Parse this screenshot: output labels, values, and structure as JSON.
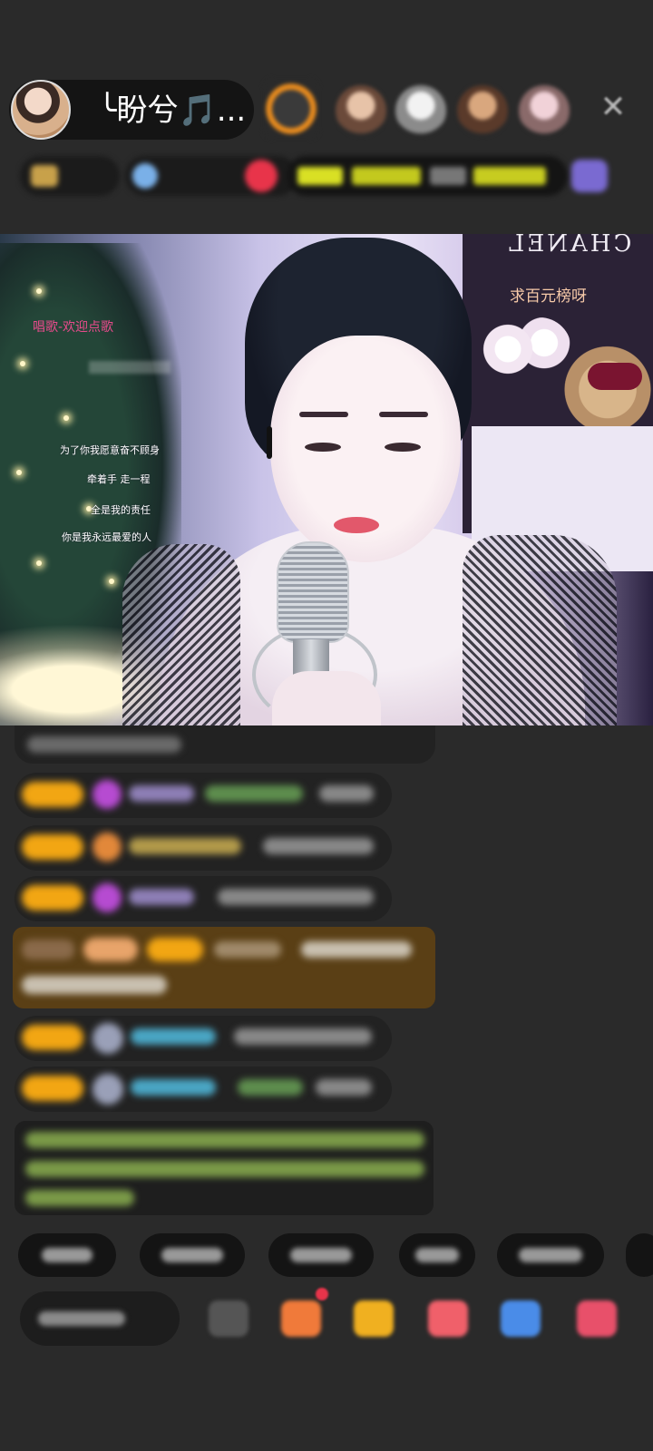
{
  "host": {
    "name": "╰盼兮🎵..."
  },
  "top_icons": {
    "close": "close-icon"
  },
  "video": {
    "brand_sign": "CHANEL",
    "overlay_text": "求百元榜呀",
    "lyrics_title": "唱歌-欢迎点歌",
    "lyrics": [
      "为了你我愿意奋不顾身",
      "牵着手 走一程",
      "全是我的责任",
      "你是我永远最爱的人"
    ]
  },
  "colors": {
    "badge": "#f2a613",
    "gem": "#b64bd1",
    "gift_row": "#5a3f15",
    "accent_red": "#e8344a"
  }
}
